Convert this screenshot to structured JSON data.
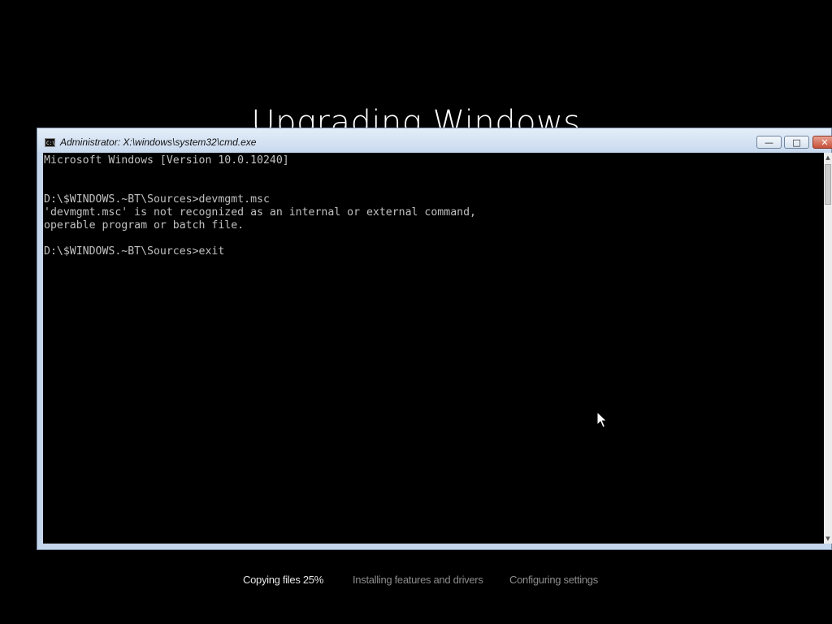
{
  "setup": {
    "title": "Upgrading Windows"
  },
  "window": {
    "title": "Administrator: X:\\windows\\system32\\cmd.exe",
    "icon": "console-icon",
    "icon_label": "C:\\",
    "minimize_glyph": "—",
    "maximize_glyph": "□",
    "close_glyph": "✕"
  },
  "console": {
    "lines": [
      "Microsoft Windows [Version 10.0.10240]",
      "",
      "",
      "D:\\$WINDOWS.~BT\\Sources>devmgmt.msc",
      "'devmgmt.msc' is not recognized as an internal or external command,",
      "operable program or batch file.",
      "",
      "D:\\$WINDOWS.~BT\\Sources>exit"
    ]
  },
  "scrollbar": {
    "up_glyph": "▲",
    "down_glyph": "▼"
  },
  "progress": {
    "steps": [
      {
        "label": "Copying files 25%",
        "active": true
      },
      {
        "label": "Installing features and drivers",
        "active": false
      },
      {
        "label": "Configuring settings",
        "active": false
      }
    ],
    "copying_percent": 25
  },
  "colors": {
    "background": "#000000",
    "console_text": "#c0c0c0",
    "titlebar": "#c8d9ee",
    "close_button": "#c7503a",
    "active_step": "#e6e6e6",
    "inactive_step": "#8c8c8c"
  }
}
